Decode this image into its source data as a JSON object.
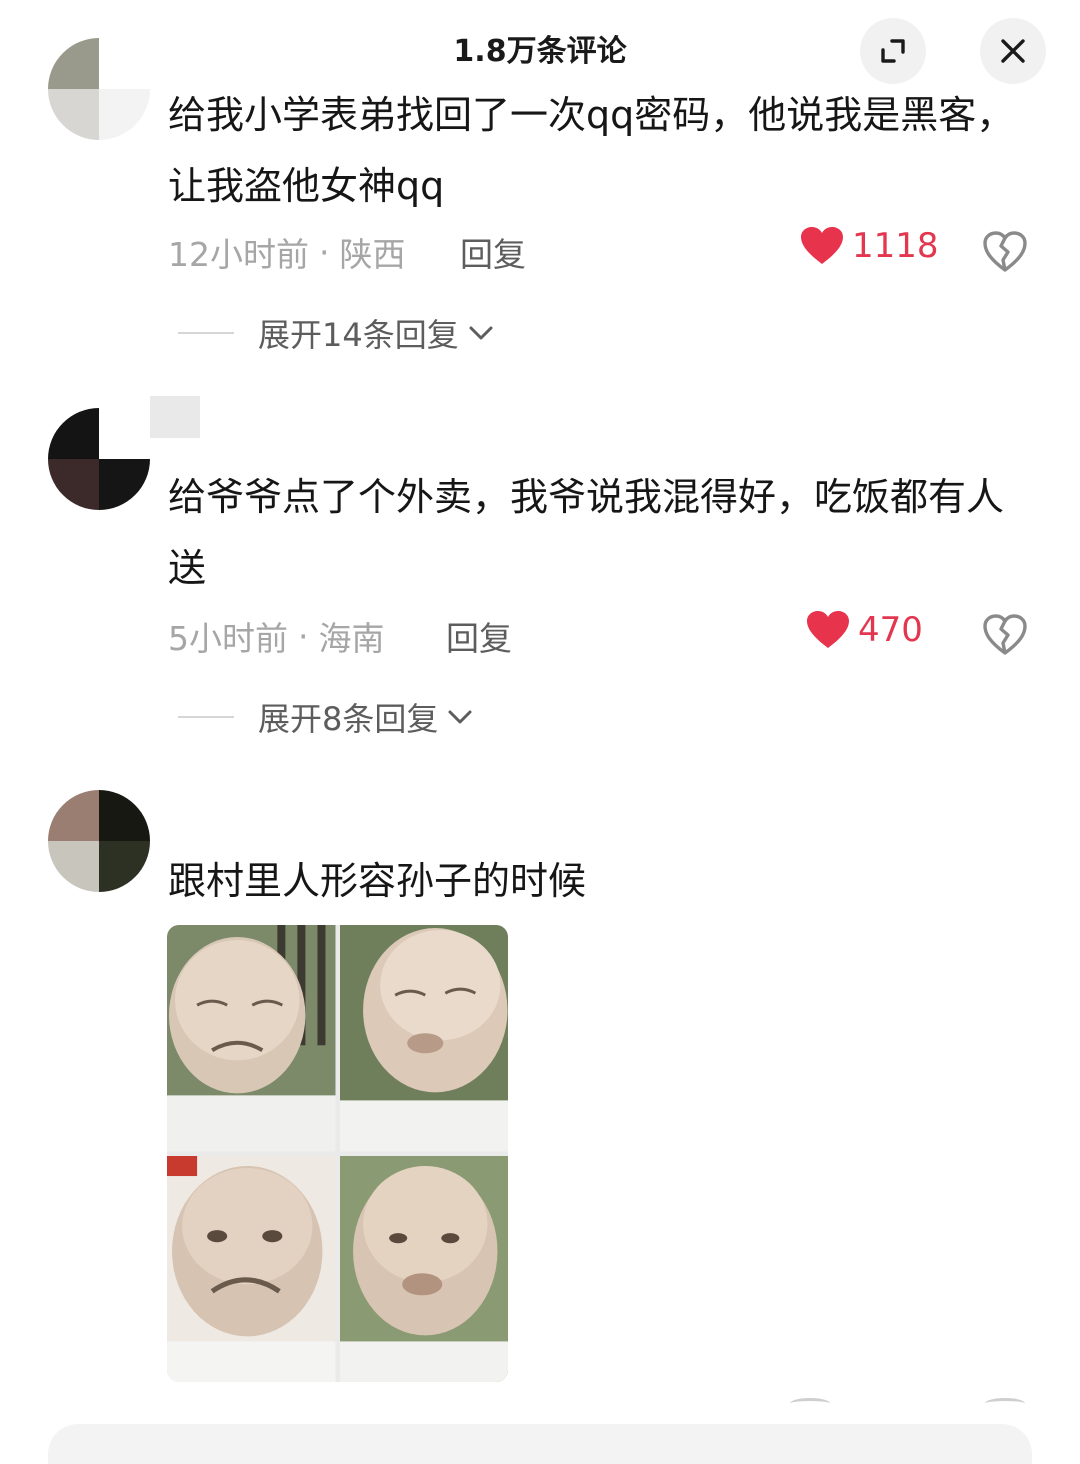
{
  "header": {
    "title": "1.8万条评论"
  },
  "comments": [
    {
      "text": "给我小学表弟找回了一次qq密码，他说我是黑客，让我盗他女神qq",
      "time": "12小时前",
      "location": "陕西",
      "reply_label": "回复",
      "likes": "1118",
      "expand_label": "展开14条回复",
      "avatar_colors": [
        "#9a9a8c",
        "#ffffff",
        "#d8d6d2",
        "#f3f3f3"
      ]
    },
    {
      "text": "给爷爷点了个外卖，我爷说我混得好，吃饭都有人送",
      "time": "5小时前",
      "location": "海南",
      "reply_label": "回复",
      "likes": "470",
      "expand_label": "展开8条回复",
      "avatar_colors": [
        "#141414",
        "#ffffff",
        "#3c2a2a",
        "#151515"
      ]
    },
    {
      "text": "跟村里人形容孙子的时候",
      "avatar_colors": [
        "#9a7e72",
        "#181813",
        "#c8c5bd",
        "#2d3124"
      ]
    }
  ],
  "colors": {
    "like": "#e3364f",
    "muted": "#a6a6a6",
    "secondary": "#5d5d5d"
  }
}
